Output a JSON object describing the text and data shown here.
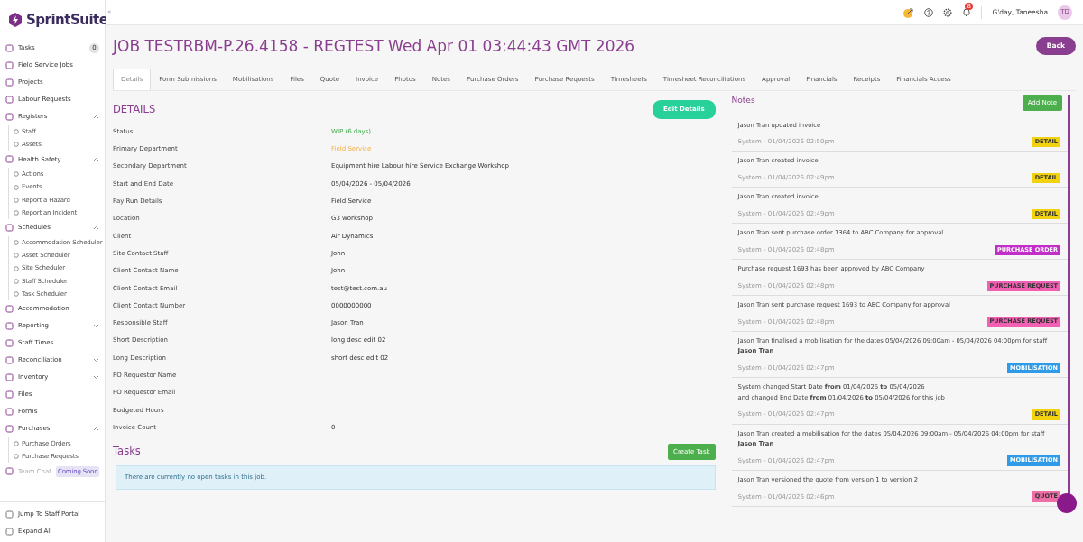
{
  "brand": {
    "name": "SprintSuite"
  },
  "header": {
    "collapse": "«",
    "notifications_count": "8",
    "greeting": "G'day, Taneesha",
    "avatar": "TD"
  },
  "sidebar": {
    "items": [
      {
        "label": "Tasks",
        "badge": "0"
      },
      {
        "label": "Field Service Jobs"
      },
      {
        "label": "Projects"
      },
      {
        "label": "Labour Requests"
      },
      {
        "label": "Registers",
        "expanded": true,
        "children": [
          {
            "label": "Staff"
          },
          {
            "label": "Assets"
          }
        ]
      },
      {
        "label": "Health Safety",
        "expanded": true,
        "children": [
          {
            "label": "Actions"
          },
          {
            "label": "Events"
          },
          {
            "label": "Report a Hazard"
          },
          {
            "label": "Report an Incident"
          }
        ]
      },
      {
        "label": "Schedules",
        "expanded": true,
        "children": [
          {
            "label": "Accommodation Scheduler"
          },
          {
            "label": "Asset Scheduler"
          },
          {
            "label": "Site Scheduler"
          },
          {
            "label": "Staff Scheduler"
          },
          {
            "label": "Task Scheduler"
          }
        ]
      },
      {
        "label": "Accommodation"
      },
      {
        "label": "Reporting",
        "expanded": false
      },
      {
        "label": "Staff Times"
      },
      {
        "label": "Reconciliation",
        "expanded": false
      },
      {
        "label": "Inventory",
        "expanded": false
      },
      {
        "label": "Files"
      },
      {
        "label": "Forms"
      },
      {
        "label": "Purchases",
        "expanded": true,
        "children": [
          {
            "label": "Purchase Orders"
          },
          {
            "label": "Purchase Requests"
          }
        ]
      },
      {
        "label": "Team Chat",
        "disabled": true,
        "tag": "Coming Soon"
      }
    ],
    "footer": [
      {
        "label": "Jump To Staff Portal"
      },
      {
        "label": "Expand All"
      }
    ]
  },
  "page": {
    "title": "JOB TESTRBM-P.26.4158 - REGTEST Wed Apr 01 03:44:43 GMT 2026",
    "back_button": "Back"
  },
  "tabs": [
    {
      "label": "Details",
      "selected": true
    },
    {
      "label": "Form Submissions",
      "selected": false
    },
    {
      "label": "Mobilisations",
      "selected": false
    },
    {
      "label": "Files",
      "selected": false
    },
    {
      "label": "Quote",
      "selected": false
    },
    {
      "label": "Invoice",
      "selected": false
    },
    {
      "label": "Photos",
      "selected": false
    },
    {
      "label": "Notes",
      "selected": false
    },
    {
      "label": "Purchase Orders",
      "selected": false
    },
    {
      "label": "Purchase Requests",
      "selected": false
    },
    {
      "label": "Timesheets",
      "selected": false
    },
    {
      "label": "Timesheet Reconciliations",
      "selected": false
    },
    {
      "label": "Approval",
      "selected": false
    },
    {
      "label": "Financials",
      "selected": false
    },
    {
      "label": "Receipts",
      "selected": false
    },
    {
      "label": "Financials Access",
      "selected": false
    }
  ],
  "details": {
    "heading": "DETAILS",
    "edit_button": "Edit Details",
    "fields": [
      {
        "label": "Status",
        "value": "WIP (6 days)",
        "kind": "status"
      },
      {
        "label": "Primary Department",
        "value": "Field Service",
        "kind": "department"
      },
      {
        "label": "Secondary Department",
        "value": "Equipment hire Labour hire Service Exchange Workshop"
      },
      {
        "label": "Start and End Date",
        "value": "05/04/2026 - 05/04/2026"
      },
      {
        "label": "Pay Run Details",
        "value": "Field Service"
      },
      {
        "label": "Location",
        "value": "G3 workshop"
      },
      {
        "label": "Client",
        "value": "Air Dynamics"
      },
      {
        "label": "Site Contact Staff",
        "value": "John"
      },
      {
        "label": "Client Contact Name",
        "value": "John"
      },
      {
        "label": "Client Contact Email",
        "value": "test@test.com.au"
      },
      {
        "label": "Client Contact Number",
        "value": "0000000000"
      },
      {
        "label": "Responsible Staff",
        "value": "Jason Tran"
      },
      {
        "label": "Short Description",
        "value": "long desc edit 02"
      },
      {
        "label": "Long Description",
        "value": "short desc edit 02"
      },
      {
        "label": "PO Requestor Name"
      },
      {
        "label": "PO Requestor Email"
      },
      {
        "label": "Budgeted Hours"
      },
      {
        "label": "Invoice Count",
        "value": "0"
      }
    ]
  },
  "tasks": {
    "heading": "Tasks",
    "create_button": "Create Task",
    "message": "There are currently no open tasks in this job."
  },
  "notes": {
    "heading": "Notes",
    "add_button": "Add Note",
    "items": [
      {
        "text": "Jason Tran updated invoice",
        "meta": "System - 01/04/2026 02:50pm",
        "tag": "DETAIL",
        "color": "#f2d20f"
      },
      {
        "text": "Jason Tran created invoice",
        "meta": "System - 01/04/2026 02:49pm",
        "tag": "DETAIL",
        "color": "#f2d20f"
      },
      {
        "text": "Jason Tran created invoice",
        "meta": "System - 01/04/2026 02:49pm",
        "tag": "DETAIL",
        "color": "#f2d20f"
      },
      {
        "text": "Jason Tran sent purchase order 1364 to ABC Company for approval",
        "meta": "System - 01/04/2026 02:48pm",
        "tag": "PURCHASE ORDER",
        "color": "#c22fc8"
      },
      {
        "text": "Purchase request 1693 has been approved by ABC Company",
        "meta": "System - 01/04/2026 02:48pm",
        "tag": "PURCHASE REQUEST",
        "color": "#f35fb3"
      },
      {
        "text": "Jason Tran sent purchase request 1693 to ABC Company for approval",
        "meta": "System - 01/04/2026 02:48pm",
        "tag": "PURCHASE REQUEST",
        "color": "#f35fb3"
      },
      {
        "text": "Jason Tran finalised a mobilisation for the dates 05/04/2026 09:00am - 05/04/2026 04:00pm for staff **Jason Tran**",
        "meta": "System - 01/04/2026 02:47pm",
        "tag": "MOBILISATION",
        "color": "#2f9ae8"
      },
      {
        "text": "System changed Start Date **from** 01/04/2026 **to** 05/04/2026",
        "text2": "and changed End Date **from** 01/04/2026 **to** 05/04/2026 for this job",
        "meta": "System - 01/04/2026 02:47pm",
        "tag": "DETAIL",
        "color": "#f2d20f"
      },
      {
        "text": "Jason Tran created a mobilisation for the dates 05/04/2026 09:00am - 05/04/2026 04:00pm for staff **Jason Tran**",
        "meta": "System - 01/04/2026 02:47pm",
        "tag": "MOBILISATION",
        "color": "#2f9ae8"
      },
      {
        "text": "Jason Tran versioned the quote from version 1 to version 2",
        "meta": "System - 01/04/2026 02:46pm",
        "tag": "QUOTE",
        "color": "#ee6fa6"
      }
    ]
  }
}
